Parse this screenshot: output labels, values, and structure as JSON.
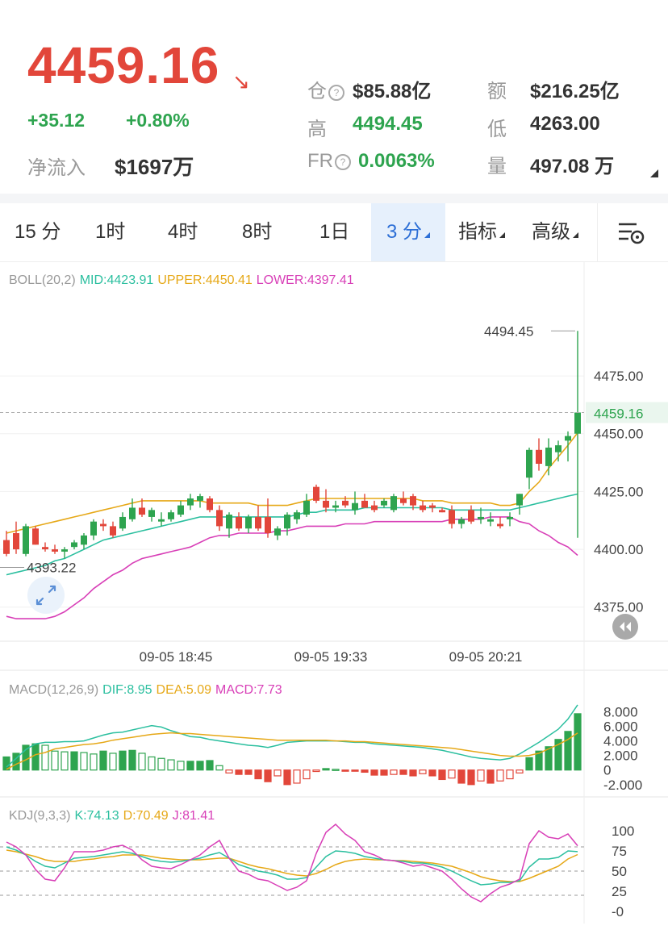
{
  "header": {
    "price": "4459.16",
    "change": "+35.12",
    "change_pct": "+0.80%",
    "net_inflow_label": "净流入",
    "net_inflow_value": "$1697万",
    "open_interest_label": "仓",
    "open_interest_value": "$85.88亿",
    "turnover_label": "额",
    "turnover_value": "$216.25亿",
    "high_label": "高",
    "high_value": "4494.45",
    "low_label": "低",
    "low_value": "4263.00",
    "fr_label": "FR",
    "fr_value": "0.0063%",
    "volume_label": "量",
    "volume_value": "497.08 万",
    "colors": {
      "up": "#2ea44f",
      "down": "#e2463a"
    }
  },
  "tabs": [
    {
      "label": "15 分"
    },
    {
      "label": "1时"
    },
    {
      "label": "4时"
    },
    {
      "label": "8时"
    },
    {
      "label": "1日"
    },
    {
      "label": "3 分",
      "active": true
    },
    {
      "label": "指标"
    },
    {
      "label": "高级"
    }
  ],
  "tool_icon": "chart-settings-icon",
  "expand_icon": "expand-icon",
  "chart_data": [
    {
      "type": "candlestick",
      "indicator": "BOLL(20,2)",
      "legend": [
        {
          "text": "BOLL(20,2)",
          "color": "#999999"
        },
        {
          "text": "MID:4423.91",
          "color": "#2bbf9f"
        },
        {
          "text": "UPPER:4450.41",
          "color": "#e6a817"
        },
        {
          "text": "LOWER:4397.41",
          "color": "#d83fb7"
        }
      ],
      "y_ticks": [
        "4475.00",
        "4450.00",
        "4425.00",
        "4400.00",
        "4375.00"
      ],
      "y_tick_values": [
        4475,
        4450,
        4425,
        4400,
        4375
      ],
      "ylim": [
        4362,
        4512
      ],
      "current_price": {
        "label": "4459.16",
        "value": 4459.16
      },
      "max_marker": {
        "label": "4494.45",
        "value": 4494.45
      },
      "min_marker": {
        "label": "4393.22",
        "value": 4393.22
      },
      "x_ticks": [
        {
          "label": "09-05 18:45",
          "index": 15
        },
        {
          "label": "09-05 19:33",
          "index": 31
        },
        {
          "label": "09-05 20:21",
          "index": 47
        }
      ],
      "candles": [
        [
          4404,
          4408,
          4397,
          4398
        ],
        [
          4407,
          4412,
          4398,
          4400
        ],
        [
          4398,
          4411,
          4397,
          4410
        ],
        [
          4409,
          4410,
          4402,
          4402
        ],
        [
          4401,
          4403,
          4399,
          4400
        ],
        [
          4400,
          4402,
          4398,
          4399
        ],
        [
          4399,
          4401,
          4396,
          4400
        ],
        [
          4401,
          4404,
          4400,
          4403
        ],
        [
          4402,
          4407,
          4400,
          4406
        ],
        [
          4406,
          4413,
          4404,
          4412
        ],
        [
          4411,
          4413,
          4408,
          4410
        ],
        [
          4410,
          4412,
          4405,
          4406
        ],
        [
          4409,
          4416,
          4408,
          4414
        ],
        [
          4413,
          4422,
          4412,
          4418
        ],
        [
          4418,
          4422,
          4414,
          4415
        ],
        [
          4414,
          4418,
          4412,
          4417
        ],
        [
          4412,
          4416,
          4410,
          4413
        ],
        [
          4413,
          4417,
          4412,
          4416
        ],
        [
          4415,
          4421,
          4414,
          4419
        ],
        [
          4419,
          4424,
          4417,
          4422
        ],
        [
          4421,
          4424,
          4418,
          4423
        ],
        [
          4422,
          4423,
          4416,
          4417
        ],
        [
          4417,
          4419,
          4408,
          4410
        ],
        [
          4409,
          4416,
          4405,
          4415
        ],
        [
          4414,
          4416,
          4408,
          4409
        ],
        [
          4409,
          4415,
          4407,
          4414
        ],
        [
          4414,
          4419,
          4408,
          4409
        ],
        [
          4414,
          4422,
          4405,
          4407
        ],
        [
          4406,
          4410,
          4404,
          4409
        ],
        [
          4409,
          4416,
          4406,
          4415
        ],
        [
          4413,
          4417,
          4411,
          4416
        ],
        [
          4415,
          4424,
          4414,
          4421
        ],
        [
          4427,
          4428,
          4420,
          4421
        ],
        [
          4421,
          4426,
          4416,
          4418
        ],
        [
          4418,
          4421,
          4416,
          4419
        ],
        [
          4421,
          4423,
          4418,
          4419
        ],
        [
          4417,
          4425,
          4415,
          4420
        ],
        [
          4421,
          4424,
          4418,
          4418
        ],
        [
          4419,
          4421,
          4416,
          4417
        ],
        [
          4419,
          4422,
          4418,
          4421
        ],
        [
          4417,
          4424,
          4416,
          4423
        ],
        [
          4422,
          4425,
          4419,
          4420
        ],
        [
          4423,
          4424,
          4417,
          4419
        ],
        [
          4419,
          4421,
          4416,
          4417
        ],
        [
          4419,
          4420,
          4416,
          4418
        ],
        [
          4417,
          4418,
          4416,
          4416
        ],
        [
          4417,
          4419,
          4409,
          4411
        ],
        [
          4411,
          4414,
          4409,
          4413
        ],
        [
          4417,
          4419,
          4411,
          4412
        ],
        [
          4413,
          4418,
          4411,
          4414
        ],
        [
          4412,
          4416,
          4410,
          4413
        ],
        [
          4411,
          4414,
          4409,
          4410
        ],
        [
          4413,
          4416,
          4410,
          4414
        ],
        [
          4419,
          4424,
          4415,
          4424
        ],
        [
          4431,
          4444,
          4426,
          4443
        ],
        [
          4443,
          4448,
          4434,
          4437
        ],
        [
          4436,
          4448,
          4432,
          4444
        ],
        [
          4442,
          4447,
          4438,
          4445
        ],
        [
          4447,
          4451,
          4438,
          4449
        ],
        [
          4450,
          4494.45,
          4405,
          4459.16
        ]
      ],
      "mid": [
        4389,
        4390,
        4391,
        4392,
        4393,
        4395,
        4396,
        4398,
        4400,
        4402,
        4404,
        4405,
        4406,
        4407,
        4408,
        4409,
        4410,
        4411,
        4412,
        4413,
        4414,
        4414,
        4414,
        4414,
        4414,
        4414,
        4414,
        4414,
        4414,
        4414,
        4415,
        4416,
        4416,
        4417,
        4417,
        4417,
        4417,
        4418,
        4418,
        4418,
        4418,
        4418,
        4418,
        4418,
        4418,
        4418,
        4417,
        4417,
        4417,
        4417,
        4417,
        4417,
        4417,
        4418,
        4419,
        4420,
        4421,
        4422,
        4423,
        4423.91
      ],
      "upper": [
        4407,
        4408,
        4409,
        4410,
        4411,
        4412,
        4413,
        4414,
        4415,
        4416,
        4417,
        4418,
        4419,
        4420,
        4421,
        4421,
        4421,
        4421,
        4421,
        4421,
        4421,
        4420,
        4420,
        4420,
        4420,
        4420,
        4419,
        4419,
        4419,
        4419,
        4420,
        4421,
        4422,
        4422,
        4422,
        4422,
        4422,
        4422,
        4422,
        4422,
        4422,
        4422,
        4422,
        4421,
        4421,
        4421,
        4420,
        4420,
        4420,
        4420,
        4420,
        4419,
        4419,
        4420,
        4425,
        4429,
        4435,
        4440,
        4445,
        4450.41
      ],
      "lower": [
        4371,
        4370,
        4370,
        4370,
        4370,
        4371,
        4373,
        4376,
        4379,
        4383,
        4386,
        4389,
        4391,
        4394,
        4396,
        4397,
        4398,
        4399,
        4400,
        4401,
        4403,
        4405,
        4406,
        4406,
        4407,
        4407,
        4407,
        4407,
        4408,
        4408,
        4409,
        4410,
        4410,
        4410,
        4410,
        4411,
        4411,
        4411,
        4412,
        4412,
        4412,
        4412,
        4412,
        4412,
        4412,
        4412,
        4413,
        4413,
        4413,
        4413,
        4414,
        4414,
        4414,
        4412,
        4411,
        4408,
        4406,
        4403,
        4401,
        4397.41
      ]
    },
    {
      "type": "bar+line",
      "indicator": "MACD(12,26,9)",
      "legend": [
        {
          "text": "MACD(12,26,9)",
          "color": "#999999"
        },
        {
          "text": "DIF:8.95",
          "color": "#2bbf9f"
        },
        {
          "text": "DEA:5.09",
          "color": "#e6a817"
        },
        {
          "text": "MACD:7.73",
          "color": "#d83fb7"
        }
      ],
      "y_ticks": [
        "8.000",
        "6.000",
        "4.000",
        "2.000",
        "0",
        "-2.000"
      ],
      "y_tick_values": [
        8,
        6,
        4,
        2,
        0,
        -2
      ],
      "ylim": [
        -2.8,
        9.6
      ],
      "hist": [
        1.8,
        2.3,
        3.4,
        3.6,
        3.4,
        2.6,
        2.5,
        2.5,
        2.4,
        2.2,
        2.6,
        2.3,
        2.6,
        2.7,
        2.3,
        1.8,
        1.6,
        1.4,
        1.2,
        1.2,
        1.2,
        1.3,
        0.6,
        -0.4,
        -0.6,
        -0.6,
        -1.2,
        -1.6,
        -0.8,
        -2.0,
        -1.8,
        -1.2,
        -0.2,
        0.2,
        0.1,
        -0.1,
        -0.1,
        -0.3,
        -0.7,
        -0.7,
        -0.6,
        -0.6,
        -0.8,
        -0.5,
        -0.8,
        -1.3,
        -1.1,
        -1.8,
        -2.0,
        -1.5,
        -1.8,
        -1.5,
        -1.2,
        -0.4,
        1.7,
        2.6,
        3.2,
        4.2,
        5.3,
        7.73
      ],
      "dif": [
        0.4,
        1.6,
        2.8,
        3.6,
        3.8,
        3.8,
        3.9,
        3.9,
        4.0,
        4.4,
        4.8,
        5.1,
        5.2,
        5.5,
        5.8,
        6.1,
        5.9,
        5.4,
        5.0,
        4.6,
        4.5,
        4.2,
        4.0,
        3.8,
        3.6,
        3.4,
        3.3,
        3.1,
        3.4,
        3.8,
        3.9,
        4.0,
        4.0,
        4.0,
        4.0,
        3.9,
        3.8,
        3.8,
        3.6,
        3.5,
        3.4,
        3.3,
        3.2,
        3.1,
        2.9,
        2.7,
        2.4,
        2.1,
        1.8,
        1.6,
        1.5,
        1.4,
        1.6,
        2.2,
        3.0,
        3.8,
        4.7,
        5.6,
        7.0,
        8.95
      ],
      "dea": [
        0.1,
        0.8,
        1.4,
        2.1,
        2.4,
        2.9,
        3.1,
        3.3,
        3.5,
        3.6,
        3.8,
        4.1,
        4.3,
        4.5,
        4.7,
        4.9,
        5.0,
        5.1,
        5.0,
        5.0,
        4.9,
        4.8,
        4.7,
        4.6,
        4.5,
        4.4,
        4.3,
        4.2,
        4.1,
        4.1,
        4.1,
        4.1,
        4.1,
        4.1,
        4.0,
        4.0,
        3.9,
        3.9,
        3.8,
        3.7,
        3.6,
        3.5,
        3.4,
        3.3,
        3.2,
        3.1,
        3.0,
        2.8,
        2.6,
        2.4,
        2.2,
        2.0,
        1.9,
        1.9,
        2.0,
        2.3,
        2.9,
        3.5,
        4.2,
        5.09
      ]
    },
    {
      "type": "line",
      "indicator": "KDJ(9,3,3)",
      "legend": [
        {
          "text": "KDJ(9,3,3)",
          "color": "#999999"
        },
        {
          "text": "K:74.13",
          "color": "#2bbf9f"
        },
        {
          "text": "D:70.49",
          "color": "#e6a817"
        },
        {
          "text": "J:81.41",
          "color": "#d83fb7"
        }
      ],
      "y_ticks": [
        "100",
        "75",
        "50",
        "25",
        "-0"
      ],
      "y_tick_values": [
        100,
        75,
        50,
        25,
        0
      ],
      "reference_lines": [
        80,
        50,
        20
      ],
      "ylim": [
        -10,
        110
      ],
      "k": [
        80,
        76,
        70,
        62,
        56,
        54,
        60,
        66,
        67,
        68,
        70,
        72,
        74,
        72,
        68,
        64,
        62,
        61,
        62,
        64,
        66,
        70,
        73,
        66,
        58,
        54,
        50,
        48,
        45,
        40,
        40,
        42,
        55,
        68,
        75,
        74,
        72,
        68,
        66,
        64,
        63,
        62,
        60,
        60,
        58,
        55,
        50,
        44,
        38,
        33,
        34,
        36,
        36,
        38,
        55,
        65,
        65,
        67,
        75,
        74.13
      ],
      "d": [
        76,
        74,
        71,
        68,
        64,
        62,
        62,
        62,
        64,
        65,
        67,
        68,
        70,
        70,
        70,
        68,
        66,
        65,
        64,
        64,
        64,
        65,
        66,
        66,
        62,
        58,
        55,
        53,
        50,
        47,
        45,
        44,
        47,
        52,
        58,
        62,
        64,
        65,
        64,
        64,
        63,
        63,
        62,
        61,
        60,
        58,
        56,
        52,
        48,
        43,
        40,
        38,
        37,
        37,
        41,
        46,
        51,
        56,
        65,
        70.49
      ],
      "j": [
        86,
        80,
        70,
        52,
        40,
        38,
        54,
        74,
        74,
        74,
        76,
        80,
        82,
        76,
        64,
        56,
        54,
        53,
        58,
        64,
        70,
        80,
        88,
        66,
        50,
        46,
        40,
        38,
        32,
        26,
        30,
        38,
        72,
        98,
        108,
        96,
        88,
        74,
        70,
        64,
        63,
        60,
        56,
        58,
        54,
        50,
        40,
        28,
        18,
        12,
        22,
        30,
        34,
        40,
        84,
        100,
        92,
        90,
        96,
        81.41
      ]
    }
  ]
}
